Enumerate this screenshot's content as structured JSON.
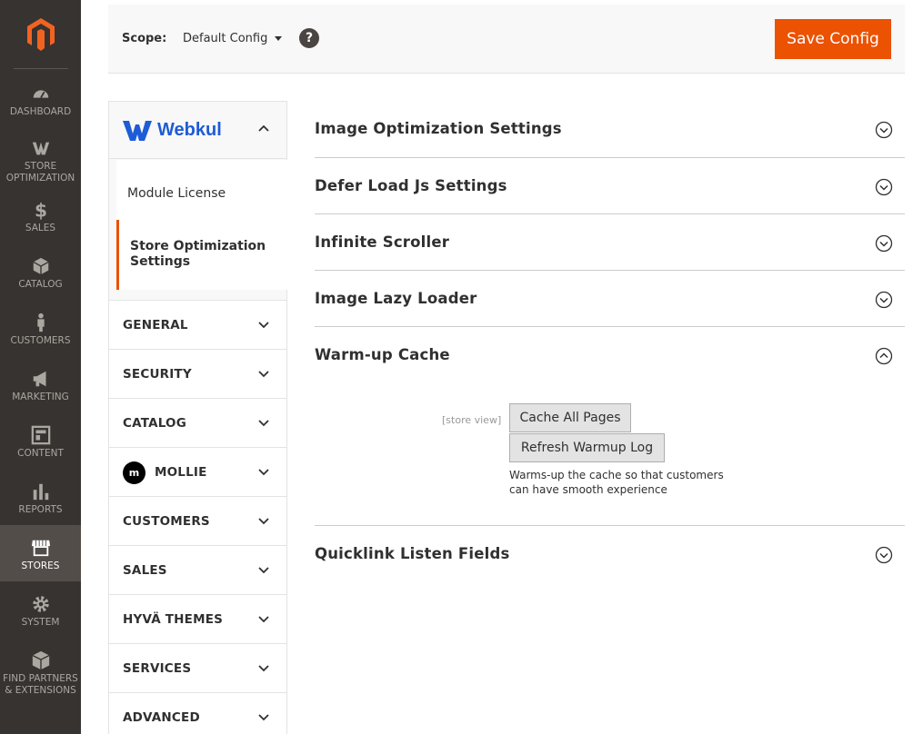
{
  "nav": {
    "items": [
      {
        "label": "DASHBOARD",
        "icon": "dashboard-icon"
      },
      {
        "label": "STORE OPTIMIZATION",
        "icon": "webkul-w-icon"
      },
      {
        "label": "SALES",
        "icon": "dollar-icon"
      },
      {
        "label": "CATALOG",
        "icon": "box-icon"
      },
      {
        "label": "CUSTOMERS",
        "icon": "person-icon"
      },
      {
        "label": "MARKETING",
        "icon": "megaphone-icon"
      },
      {
        "label": "CONTENT",
        "icon": "layout-icon"
      },
      {
        "label": "REPORTS",
        "icon": "bar-chart-icon"
      },
      {
        "label": "STORES",
        "icon": "store-icon",
        "active": true
      },
      {
        "label": "SYSTEM",
        "icon": "gear-icon"
      },
      {
        "label": "FIND PARTNERS & EXTENSIONS",
        "icon": "blocks-icon"
      }
    ]
  },
  "header": {
    "scope_label": "Scope:",
    "scope_value": "Default Config",
    "help": "?",
    "save_label": "Save Config"
  },
  "sidebar": {
    "brand": "Webkul",
    "sub_items": [
      "Module License",
      "Store Optimization Settings"
    ],
    "sections": [
      "GENERAL",
      "SECURITY",
      "CATALOG",
      "MOLLIE",
      "CUSTOMERS",
      "SALES",
      "HYVÄ THEMES",
      "SERVICES",
      "ADVANCED"
    ],
    "mollie_badge": "m"
  },
  "main": {
    "groups": [
      "Image Optimization Settings",
      "Defer Load Js Settings",
      "Infinite Scroller",
      "Image Lazy Loader",
      "Warm-up Cache",
      "Quicklink Listen Fields"
    ],
    "warmup": {
      "scope": "[store view]",
      "cache_all_label": "Cache All Pages",
      "refresh_label": "Refresh Warmup Log",
      "note": "Warms-up the cache so that customers can have smooth experience"
    }
  },
  "colors": {
    "accent": "#eb5202",
    "nav_bg": "#373330",
    "brand_blue": "#1e5bd6"
  }
}
